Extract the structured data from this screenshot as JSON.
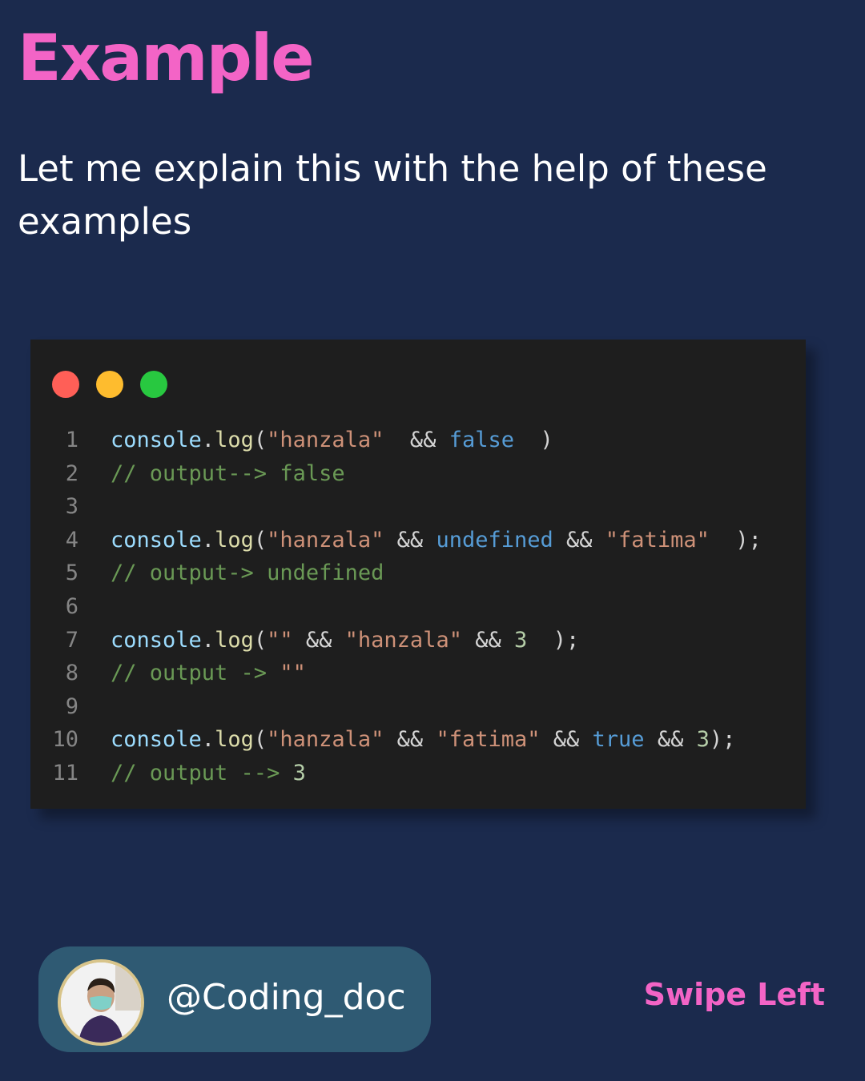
{
  "title": "Example",
  "subtitle": "Let me explain this with the help of these examples",
  "colors": {
    "background": "#1b2a4d",
    "accent": "#f364c6",
    "code_background": "#1e1e1e",
    "dot_red": "#ff5f57",
    "dot_yellow": "#febc2e",
    "dot_green": "#28c840"
  },
  "code_lines": [
    {
      "n": "1",
      "tokens": [
        [
          "ident",
          "console"
        ],
        [
          "punc",
          "."
        ],
        [
          "fn",
          "log"
        ],
        [
          "punc",
          "("
        ],
        [
          "str",
          "\"hanzala\""
        ],
        [
          "punc",
          "  && "
        ],
        [
          "kw",
          "false"
        ],
        [
          "punc",
          "  )"
        ]
      ]
    },
    {
      "n": "2",
      "tokens": [
        [
          "comment",
          "// output--> false"
        ]
      ]
    },
    {
      "n": "3",
      "tokens": []
    },
    {
      "n": "4",
      "tokens": [
        [
          "ident",
          "console"
        ],
        [
          "punc",
          "."
        ],
        [
          "fn",
          "log"
        ],
        [
          "punc",
          "("
        ],
        [
          "str",
          "\"hanzala\""
        ],
        [
          "punc",
          " && "
        ],
        [
          "kw",
          "undefined"
        ],
        [
          "punc",
          " && "
        ],
        [
          "str",
          "\"fatima\""
        ],
        [
          "punc",
          "  );"
        ]
      ]
    },
    {
      "n": "5",
      "tokens": [
        [
          "comment",
          "// output-> undefined"
        ]
      ]
    },
    {
      "n": "6",
      "tokens": []
    },
    {
      "n": "7",
      "tokens": [
        [
          "ident",
          "console"
        ],
        [
          "punc",
          "."
        ],
        [
          "fn",
          "log"
        ],
        [
          "punc",
          "("
        ],
        [
          "str",
          "\"\""
        ],
        [
          "punc",
          " && "
        ],
        [
          "str",
          "\"hanzala\""
        ],
        [
          "punc",
          " && "
        ],
        [
          "num",
          "3"
        ],
        [
          "punc",
          "  );"
        ]
      ]
    },
    {
      "n": "8",
      "tokens": [
        [
          "comment",
          "// output -> "
        ],
        [
          "str",
          "\"\""
        ]
      ]
    },
    {
      "n": "9",
      "tokens": []
    },
    {
      "n": "10",
      "tokens": [
        [
          "ident",
          "console"
        ],
        [
          "punc",
          "."
        ],
        [
          "fn",
          "log"
        ],
        [
          "punc",
          "("
        ],
        [
          "str",
          "\"hanzala\""
        ],
        [
          "punc",
          " && "
        ],
        [
          "str",
          "\"fatima\""
        ],
        [
          "punc",
          " && "
        ],
        [
          "kw",
          "true"
        ],
        [
          "punc",
          " && "
        ],
        [
          "num",
          "3"
        ],
        [
          "punc",
          ");"
        ]
      ]
    },
    {
      "n": "11",
      "tokens": [
        [
          "comment",
          "// output --> "
        ],
        [
          "num",
          "3"
        ]
      ]
    }
  ],
  "profile": {
    "handle": "@Coding_doc",
    "avatar_icon": "user-avatar"
  },
  "swipe_label": "Swipe Left"
}
